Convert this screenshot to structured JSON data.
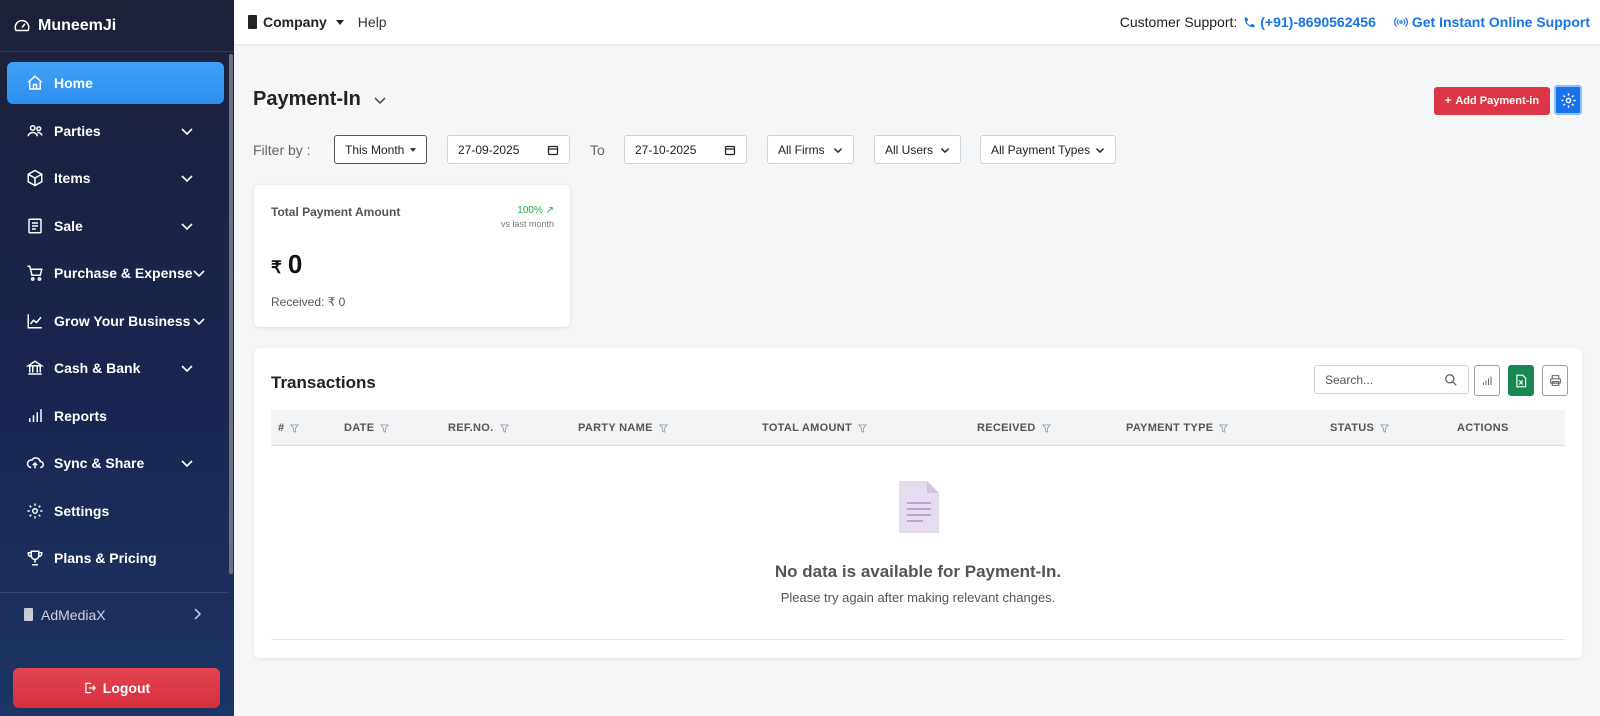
{
  "app": {
    "name": "MuneemJi"
  },
  "sidebar": {
    "items": [
      {
        "label": "Home",
        "icon": "home-icon",
        "active": true
      },
      {
        "label": "Parties",
        "icon": "users-icon",
        "expandable": true
      },
      {
        "label": "Items",
        "icon": "box-icon",
        "expandable": true
      },
      {
        "label": "Sale",
        "icon": "receipt-icon",
        "expandable": true
      },
      {
        "label": "Purchase & Expense",
        "icon": "cart-icon",
        "expandable": true
      },
      {
        "label": "Grow Your Business",
        "icon": "trend-icon",
        "expandable": true
      },
      {
        "label": "Cash & Bank",
        "icon": "bank-icon",
        "expandable": true
      },
      {
        "label": "Reports",
        "icon": "bar-chart-icon"
      },
      {
        "label": "Sync & Share",
        "icon": "cloud-upload-icon",
        "expandable": true
      },
      {
        "label": "Settings",
        "icon": "gear-icon"
      },
      {
        "label": "Plans & Pricing",
        "icon": "trophy-icon"
      }
    ],
    "company": "AdMediaX",
    "logout_label": "Logout"
  },
  "topbar": {
    "company_label": "Company",
    "help_label": "Help",
    "support_label": "Customer Support:",
    "phone": "(+91)-8690562456",
    "online_support": "Get Instant Online Support"
  },
  "page": {
    "title": "Payment-In",
    "add_button": "Add Payment-in",
    "filter_label": "Filter by :",
    "period": "This Month",
    "from_date": "27-09-2025",
    "to_label": "To",
    "to_date": "27-10-2025",
    "firms": "All Firms",
    "users": "All Users",
    "payment_types": "All Payment Types"
  },
  "summary": {
    "label": "Total Payment Amount",
    "change": "100% ↗",
    "vs": "vs last month",
    "currency": "₹",
    "amount": "0",
    "received": "Received: ₹ 0"
  },
  "transactions": {
    "title": "Transactions",
    "search_placeholder": "Search...",
    "columns": [
      "#",
      "DATE",
      "REF.NO.",
      "PARTY NAME",
      "TOTAL AMOUNT",
      "RECEIVED",
      "PAYMENT TYPE",
      "STATUS",
      "ACTIONS"
    ],
    "empty_title": "No data is available for Payment-In.",
    "empty_sub": "Please try again after making relevant changes."
  },
  "colors": {
    "primary": "#1a73e8",
    "danger": "#dc3545",
    "success": "#198754",
    "sidebar_active": "#3a9af3"
  }
}
